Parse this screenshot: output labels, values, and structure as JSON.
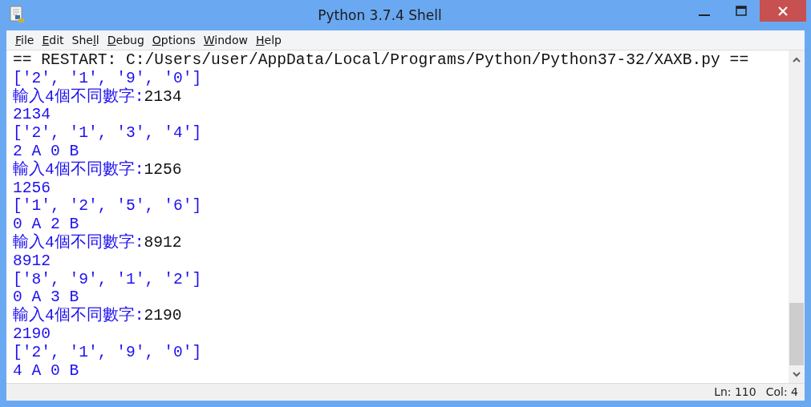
{
  "window": {
    "title": "Python 3.7.4 Shell"
  },
  "menu": [
    {
      "key": "F",
      "after": "ile"
    },
    {
      "key": "E",
      "after": "dit"
    },
    {
      "before": "She",
      "key": "l",
      "after": "l"
    },
    {
      "key": "D",
      "after": "ebug"
    },
    {
      "key": "O",
      "after": "ptions"
    },
    {
      "key": "W",
      "after": "indow"
    },
    {
      "key": "H",
      "after": "elp"
    }
  ],
  "lines": [
    [
      {
        "kind": "restart",
        "text": "== RESTART: C:/Users/user/AppData/Local/Programs/Python/Python37-32/XAXB.py =="
      }
    ],
    [
      {
        "kind": "output",
        "text": "['2', '1', '9', '0']"
      }
    ],
    [
      {
        "kind": "output",
        "text": "輸入4個不同數字:"
      },
      {
        "kind": "input",
        "text": "2134"
      }
    ],
    [
      {
        "kind": "output",
        "text": "2134"
      }
    ],
    [
      {
        "kind": "output",
        "text": "['2', '1', '3', '4']"
      }
    ],
    [
      {
        "kind": "output",
        "text": "2 A 0 B"
      }
    ],
    [
      {
        "kind": "output",
        "text": "輸入4個不同數字:"
      },
      {
        "kind": "input",
        "text": "1256"
      }
    ],
    [
      {
        "kind": "output",
        "text": "1256"
      }
    ],
    [
      {
        "kind": "output",
        "text": "['1', '2', '5', '6']"
      }
    ],
    [
      {
        "kind": "output",
        "text": "0 A 2 B"
      }
    ],
    [
      {
        "kind": "output",
        "text": "輸入4個不同數字:"
      },
      {
        "kind": "input",
        "text": "8912"
      }
    ],
    [
      {
        "kind": "output",
        "text": "8912"
      }
    ],
    [
      {
        "kind": "output",
        "text": "['8', '9', '1', '2']"
      }
    ],
    [
      {
        "kind": "output",
        "text": "0 A 3 B"
      }
    ],
    [
      {
        "kind": "output",
        "text": "輸入4個不同數字:"
      },
      {
        "kind": "input",
        "text": "2190"
      }
    ],
    [
      {
        "kind": "output",
        "text": "2190"
      }
    ],
    [
      {
        "kind": "output",
        "text": "['2', '1', '9', '0']"
      }
    ],
    [
      {
        "kind": "output",
        "text": "4 A 0 B"
      }
    ]
  ],
  "status_bar": {
    "line": "Ln: 110",
    "column": "Col: 4"
  }
}
